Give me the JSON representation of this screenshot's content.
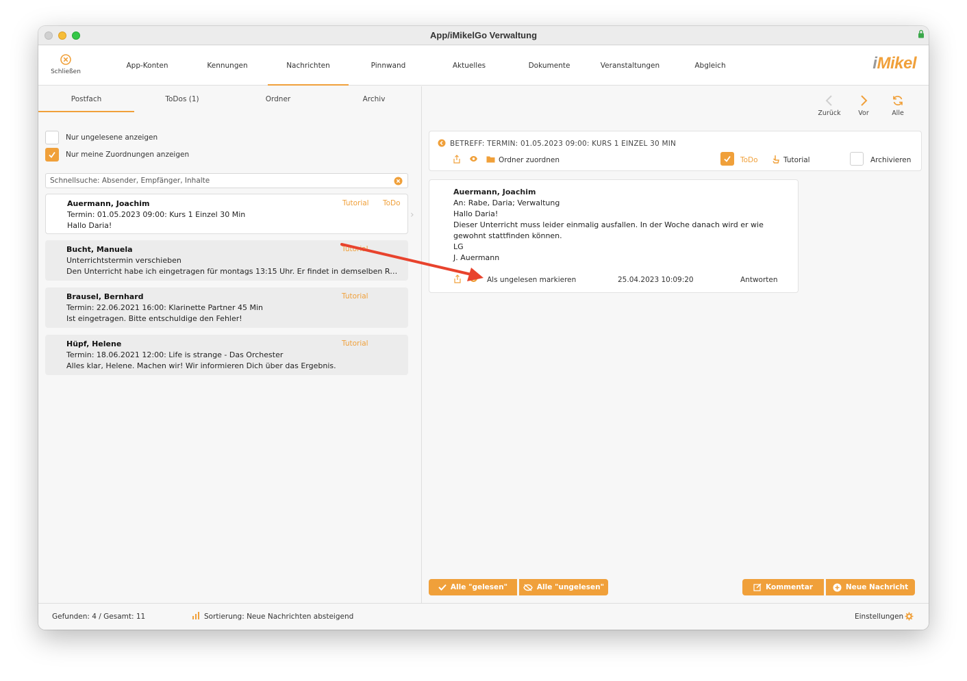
{
  "window": {
    "title": "App/iMikelGo Verwaltung"
  },
  "toolbar": {
    "close_label": "Schließen",
    "tabs": [
      "App-Konten",
      "Kennungen",
      "Nachrichten",
      "Pinnwand",
      "Aktuelles",
      "Dokumente",
      "Veranstaltungen",
      "Abgleich"
    ],
    "active_tab": "Nachrichten",
    "logo_i": "i",
    "logo_rest": "Mikel"
  },
  "left": {
    "subtabs": [
      "Postfach",
      "ToDos (1)",
      "Ordner",
      "Archiv"
    ],
    "active_subtab": "Postfach",
    "filters": [
      {
        "label": "Nur ungelesene anzeigen",
        "checked": false
      },
      {
        "label": "Nur meine Zuordnungen anzeigen",
        "checked": true
      }
    ],
    "search_placeholder": "Schnellsuche: Absender, Empfänger, Inhalte",
    "messages": [
      {
        "sender": "Auermann, Joachim",
        "subject": "Termin: 01.05.2023 09:00: Kurs 1 Einzel 30 Min",
        "preview": "Hallo Daria!",
        "tags": [
          "Tutorial",
          "ToDo"
        ],
        "selected": true
      },
      {
        "sender": "Bucht, Manuela",
        "subject": "Unterrichtstermin verschieben",
        "preview": "Den Unterricht habe ich eingetragen für montags 13:15 Uhr. Er findet in demselben Raum statt.",
        "tags": [
          "Tutorial"
        ],
        "selected": false
      },
      {
        "sender": "Brausel, Bernhard",
        "subject": "Termin: 22.06.2021 16:00: Klarinette Partner 45 Min",
        "preview": "Ist eingetragen. Bitte entschuldige den Fehler!",
        "tags": [
          "Tutorial"
        ],
        "selected": false
      },
      {
        "sender": "Hüpf, Helene",
        "subject": "Termin: 18.06.2021 12:00: Life is strange - Das Orchester",
        "preview": "Alles klar, Helene. Machen wir! Wir informieren Dich über das Ergebnis.",
        "tags": [
          "Tutorial"
        ],
        "selected": false
      }
    ]
  },
  "right": {
    "nav": {
      "back": "Zurück",
      "next": "Vor",
      "all": "Alle"
    },
    "subject": "BETREFF: TERMIN: 01.05.2023 09:00: KURS 1 EINZEL 30 MIN",
    "actions": {
      "folder": "Ordner zuordnen",
      "todo": "ToDo",
      "tutorial": "Tutorial",
      "archive": "Archivieren"
    },
    "detail": {
      "from": "Auermann, Joachim",
      "to": "An: Rabe, Daria; Verwaltung",
      "lines": [
        "Hallo Daria!",
        "Dieser Unterricht muss leider einmalig ausfallen. In der Woche danach wird er wie",
        "gewohnt stattfinden können.",
        "LG",
        "J. Auermann"
      ],
      "mark_unread": "Als ungelesen markieren",
      "timestamp": "25.04.2023 10:09:20",
      "reply": "Antworten"
    },
    "buttons": {
      "all_read": "Alle \"gelesen\"",
      "all_unread": "Alle \"ungelesen\"",
      "comment": "Kommentar",
      "new_message": "Neue Nachricht"
    }
  },
  "status": {
    "found": "Gefunden: 4 / Gesamt: 11",
    "sort": "Sortierung: Neue Nachrichten absteigend",
    "settings": "Einstellungen"
  },
  "colors": {
    "accent": "#f0a03a",
    "annotation_arrow": "#e8432d",
    "lock": "#3aa84a"
  }
}
